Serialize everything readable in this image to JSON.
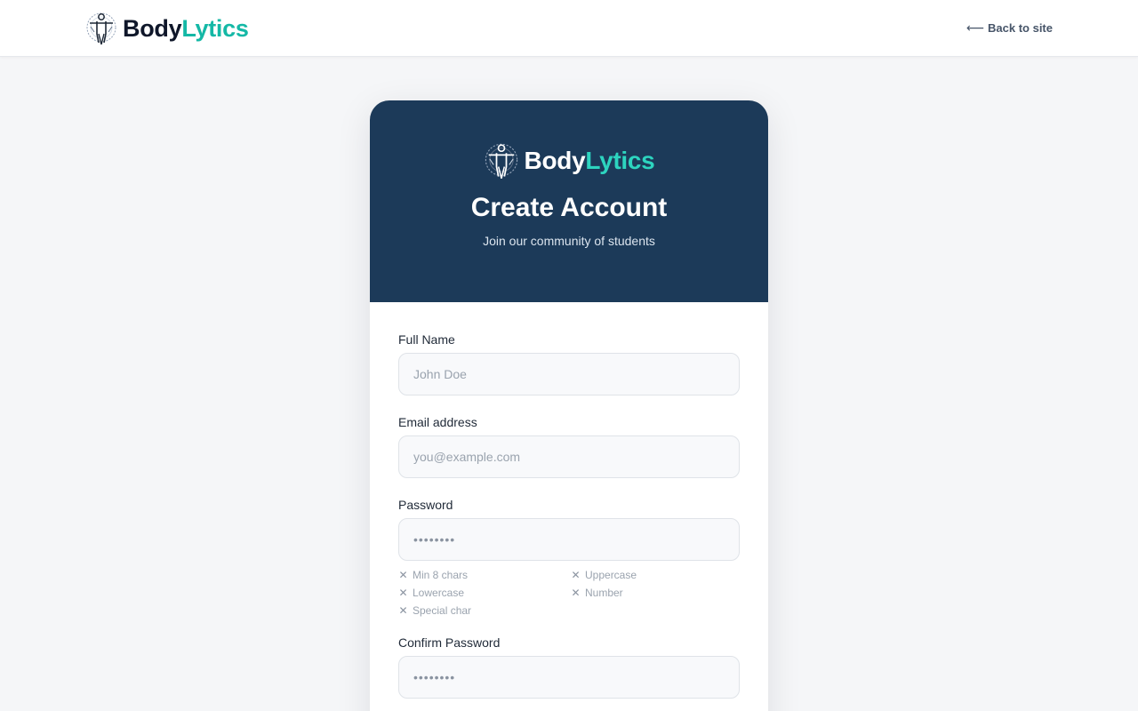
{
  "header": {
    "brand_part1": "Body",
    "brand_part2": "Lytics",
    "back_link": "Back to site",
    "back_arrow": "⟵"
  },
  "card": {
    "brand_part1": "Body",
    "brand_part2": "Lytics",
    "title": "Create Account",
    "subtitle": "Join our community of students"
  },
  "form": {
    "full_name": {
      "label": "Full Name",
      "placeholder": "John Doe",
      "value": ""
    },
    "email": {
      "label": "Email address",
      "placeholder": "you@example.com",
      "value": ""
    },
    "password": {
      "label": "Password",
      "placeholder": "••••••••",
      "value": "",
      "rules": [
        {
          "icon": "✕",
          "label": "Min 8 chars"
        },
        {
          "icon": "✕",
          "label": "Uppercase"
        },
        {
          "icon": "✕",
          "label": "Lowercase"
        },
        {
          "icon": "✕",
          "label": "Number"
        },
        {
          "icon": "✕",
          "label": "Special char"
        }
      ]
    },
    "confirm_password": {
      "label": "Confirm Password",
      "placeholder": "••••••••",
      "value": ""
    }
  },
  "colors": {
    "brand_dark": "#0f172a",
    "brand_accent": "#14b8a6",
    "header_bg": "#1c3a59",
    "page_bg": "#f5f6f8"
  },
  "icons": {
    "logo": "vitruvian-figure-logo-icon",
    "back": "arrow-left-icon",
    "rule_unmet": "x-mark-icon"
  }
}
